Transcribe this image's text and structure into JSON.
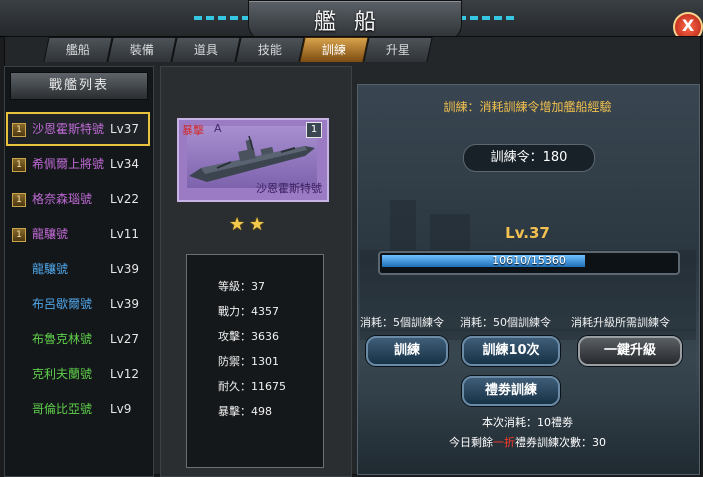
{
  "window": {
    "title": "艦船",
    "close_label": "X"
  },
  "tabs": [
    "艦船",
    "裝備",
    "道具",
    "技能",
    "訓練",
    "升星"
  ],
  "active_tab": "訓練",
  "ship_list": {
    "header": "戰艦列表",
    "items": [
      {
        "badge": "1",
        "name": "沙恩霍斯特號",
        "level": "Lv37",
        "color": "#c06bd6",
        "selected": true
      },
      {
        "badge": "1",
        "name": "希佩爾上將號",
        "level": "Lv34",
        "color": "#c06bd6"
      },
      {
        "badge": "1",
        "name": "格奈森瑙號",
        "level": "Lv22",
        "color": "#c06bd6"
      },
      {
        "badge": "1",
        "name": "龍驤號",
        "level": "Lv11",
        "color": "#c06bd6"
      },
      {
        "badge": "",
        "name": "龍驤號",
        "level": "Lv39",
        "color": "#4fa6e8"
      },
      {
        "badge": "",
        "name": "布呂歇爾號",
        "level": "Lv39",
        "color": "#4fa6e8"
      },
      {
        "badge": "",
        "name": "布魯克林號",
        "level": "Lv27",
        "color": "#5fd04a"
      },
      {
        "badge": "",
        "name": "克利夫蘭號",
        "level": "Lv12",
        "color": "#5fd04a"
      },
      {
        "badge": "",
        "name": "哥倫比亞號",
        "level": "Lv9",
        "color": "#5fd04a"
      }
    ]
  },
  "card": {
    "type": "暴擊",
    "grade": "A",
    "level_badge": "1",
    "name": "沙恩霍斯特號",
    "stars": 2
  },
  "stats": [
    "等級：37",
    "戰力：4357",
    "攻擊：3636",
    "防禦：1301",
    "耐久：11675",
    "暴擊：498"
  ],
  "training": {
    "description": "訓練：消耗訓練令增加艦船經驗",
    "token_label": "訓練令：180",
    "level": "Lv.37",
    "exp_current": 10610,
    "exp_max": 15360,
    "exp_text": "10610/15360",
    "costs": [
      "消耗：5個訓練令",
      "消耗：50個訓練令",
      "消耗升級所需訓練令"
    ],
    "buttons": {
      "train": "訓練",
      "train10": "訓練10次",
      "oneclick": "一鍵升級",
      "gift": "禮劵訓練"
    },
    "info_cost": "本次消耗：10禮劵",
    "info_remaining_prefix": "今日剩餘",
    "info_remaining_red": "一折",
    "info_remaining_suffix": "禮券訓練次數：30"
  }
}
